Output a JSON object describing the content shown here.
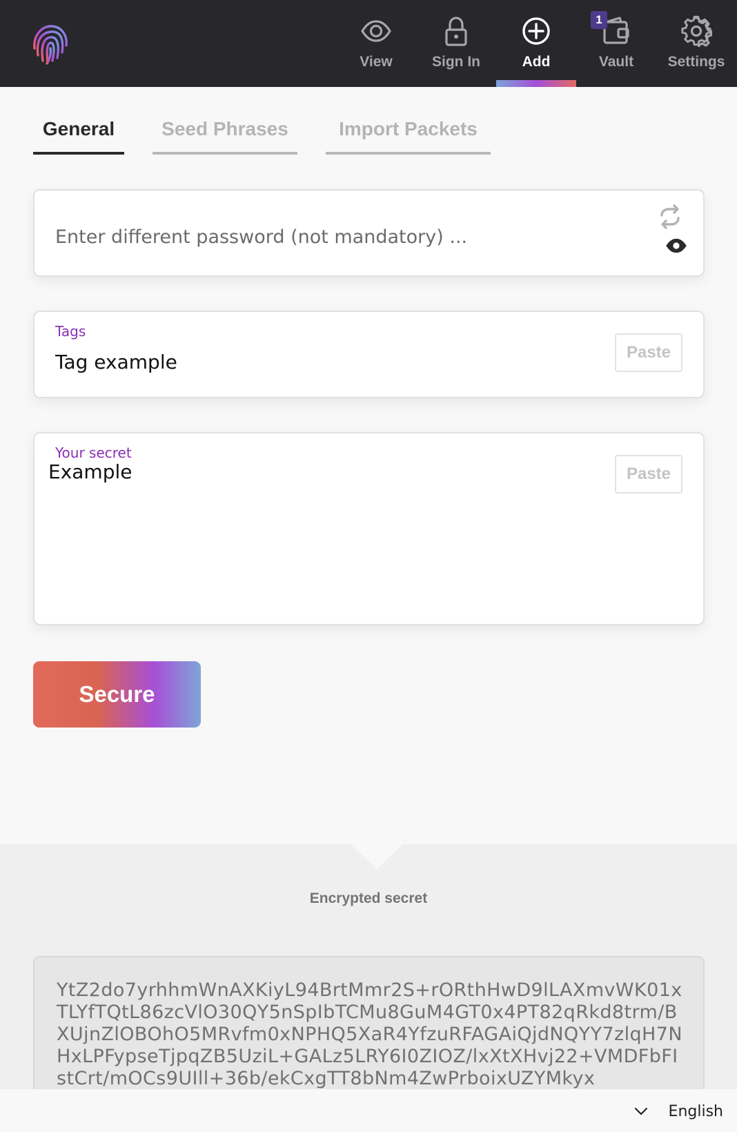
{
  "header": {
    "logo_icon": "fingerprint-icon",
    "nav": [
      {
        "label": "View",
        "icon": "eye-icon"
      },
      {
        "label": "Sign In",
        "icon": "lock-icon"
      },
      {
        "label": "Add",
        "icon": "plus-circle-icon",
        "active": true
      },
      {
        "label": "Vault",
        "icon": "wallet-icon",
        "badge": "1"
      },
      {
        "label": "Settings",
        "icon": "gear-icon"
      }
    ]
  },
  "tabs": [
    {
      "label": "General",
      "active": true
    },
    {
      "label": "Seed Phrases"
    },
    {
      "label": "Import Packets"
    }
  ],
  "form": {
    "password_placeholder": "Enter different password (not mandatory) ...",
    "tags_label": "Tags",
    "tags_value": "Tag example",
    "secret_label": "Your secret",
    "secret_value": "Example",
    "paste_label": "Paste",
    "secure_label": "Secure"
  },
  "encrypted": {
    "title": "Encrypted secret",
    "value": "YtZ2do7yrhhmWnAXKiyL94BrtMmr2S+rORthHwD9lLAXmvWK01xTLYfTQtL86zcVlO30QY5nSpIbTCMu8GuM4GT0x4PT82qRkd8trm/BXUjnZlOBOhO5MRvfm0xNPHQ5XaR4YfzuRFAGAiQjdNQYY7zlqH7NHxLPFypseTjpqZB5UziL+GALz5LRY6I0ZIOZ/lxXtXHvj22+VMDFbFIstCrt/mOCs9UIll+36b/ekCxgTT8bNm4ZwPrboixUZYMkyx"
  },
  "footer": {
    "language": "English"
  },
  "colors": {
    "topbar": "#28272b",
    "accent_purple": "#8b2fb3",
    "gradient": [
      "#e26a5c",
      "#a74fd6",
      "#7ea6d8"
    ]
  }
}
